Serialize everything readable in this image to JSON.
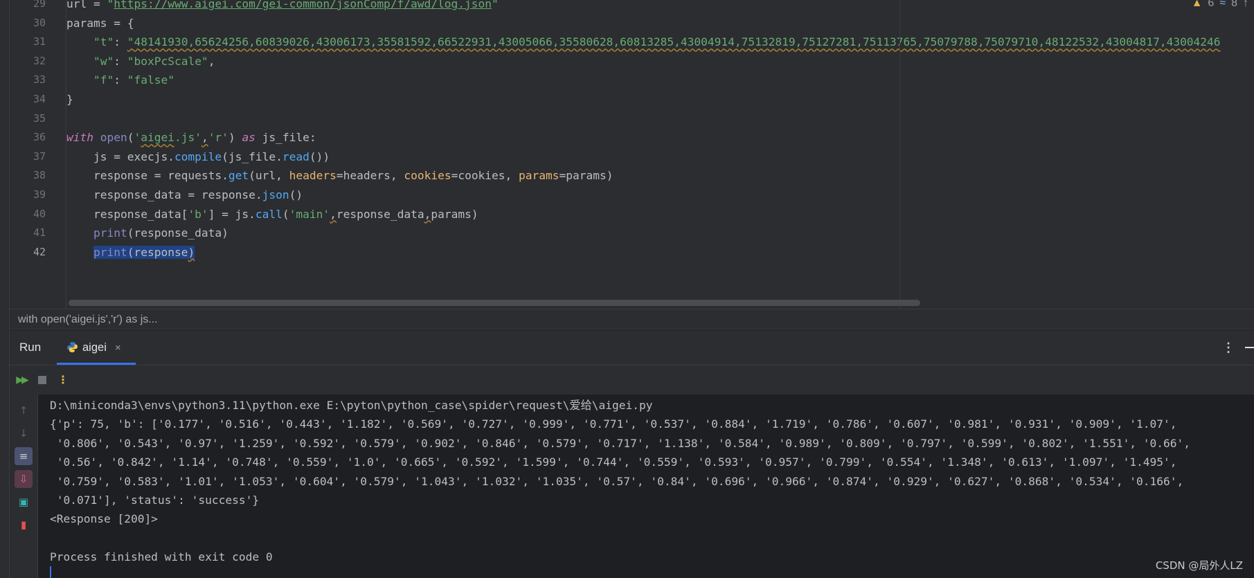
{
  "editor": {
    "line_numbers": [
      "29",
      "30",
      "31",
      "32",
      "33",
      "34",
      "35",
      "36",
      "37",
      "38",
      "39",
      "40",
      "41",
      "42"
    ],
    "lines": [
      {
        "num": "29",
        "tokens": [
          {
            "t": "url = ",
            "c": "nm"
          },
          {
            "t": "\"",
            "c": "str"
          },
          {
            "t": "https://www.aigei.com/gei-common/jsonComp/f/awd/log.json",
            "c": "url"
          },
          {
            "t": "\"",
            "c": "str"
          }
        ]
      },
      {
        "num": "30",
        "tokens": [
          {
            "t": "params = {",
            "c": "nm"
          }
        ]
      },
      {
        "num": "31",
        "tokens": [
          {
            "t": "    ",
            "c": "nm"
          },
          {
            "t": "\"t\"",
            "c": "str"
          },
          {
            "t": ": ",
            "c": "nm"
          },
          {
            "t": "\"48141930,65624256,60839026,43006173,35581592,66522931,43005066,35580628,60813285,43004914,75132819,75127281,75113765,75079788,75079710,48122532,43004817,43004246",
            "c": "str wavy"
          }
        ]
      },
      {
        "num": "32",
        "tokens": [
          {
            "t": "    ",
            "c": "nm"
          },
          {
            "t": "\"w\"",
            "c": "str"
          },
          {
            "t": ": ",
            "c": "nm"
          },
          {
            "t": "\"boxPcScale\"",
            "c": "str"
          },
          {
            "t": ",",
            "c": "nm"
          }
        ]
      },
      {
        "num": "33",
        "tokens": [
          {
            "t": "    ",
            "c": "nm"
          },
          {
            "t": "\"f\"",
            "c": "str"
          },
          {
            "t": ": ",
            "c": "nm"
          },
          {
            "t": "\"false\"",
            "c": "str"
          }
        ]
      },
      {
        "num": "34",
        "tokens": [
          {
            "t": "}",
            "c": "nm"
          }
        ]
      },
      {
        "num": "35",
        "tokens": []
      },
      {
        "num": "36",
        "tokens": [
          {
            "t": "with",
            "c": "kwp"
          },
          {
            "t": " ",
            "c": "nm"
          },
          {
            "t": "open",
            "c": "bi"
          },
          {
            "t": "(",
            "c": "nm"
          },
          {
            "t": "'",
            "c": "str"
          },
          {
            "t": "aigei",
            "c": "str wavy"
          },
          {
            "t": ".js'",
            "c": "str"
          },
          {
            "t": ",",
            "c": "nm wavy"
          },
          {
            "t": "'r'",
            "c": "str"
          },
          {
            "t": ") ",
            "c": "nm"
          },
          {
            "t": "as",
            "c": "kwp"
          },
          {
            "t": " js_file:",
            "c": "nm"
          }
        ]
      },
      {
        "num": "37",
        "tokens": [
          {
            "t": "    js = execjs.",
            "c": "nm"
          },
          {
            "t": "compile",
            "c": "fn"
          },
          {
            "t": "(js_file.",
            "c": "nm"
          },
          {
            "t": "read",
            "c": "fn"
          },
          {
            "t": "())",
            "c": "nm"
          }
        ]
      },
      {
        "num": "38",
        "tokens": [
          {
            "t": "    response = requests.",
            "c": "nm"
          },
          {
            "t": "get",
            "c": "fn"
          },
          {
            "t": "(url, ",
            "c": "nm"
          },
          {
            "t": "headers",
            "c": "param"
          },
          {
            "t": "=headers, ",
            "c": "nm"
          },
          {
            "t": "cookies",
            "c": "param"
          },
          {
            "t": "=cookies, ",
            "c": "nm"
          },
          {
            "t": "params",
            "c": "param"
          },
          {
            "t": "=params)",
            "c": "nm"
          }
        ]
      },
      {
        "num": "39",
        "tokens": [
          {
            "t": "    response_data = response.",
            "c": "nm"
          },
          {
            "t": "json",
            "c": "fn"
          },
          {
            "t": "()",
            "c": "nm"
          }
        ]
      },
      {
        "num": "40",
        "tokens": [
          {
            "t": "    response_data[",
            "c": "nm"
          },
          {
            "t": "'b'",
            "c": "str"
          },
          {
            "t": "] = js.",
            "c": "nm"
          },
          {
            "t": "call",
            "c": "fn"
          },
          {
            "t": "(",
            "c": "nm"
          },
          {
            "t": "'main'",
            "c": "str"
          },
          {
            "t": ",",
            "c": "nm wavy"
          },
          {
            "t": "response_data",
            "c": "nm"
          },
          {
            "t": ",",
            "c": "nm wavy"
          },
          {
            "t": "params)",
            "c": "nm"
          }
        ]
      },
      {
        "num": "41",
        "tokens": [
          {
            "t": "    ",
            "c": "nm"
          },
          {
            "t": "print",
            "c": "bi"
          },
          {
            "t": "(response_data)",
            "c": "nm"
          }
        ]
      },
      {
        "num": "42",
        "tokens": [
          {
            "t": "    ",
            "c": "nm"
          },
          {
            "t": "print",
            "c": "bi hl-sel"
          },
          {
            "t": "(response",
            "c": "nm hl-sel"
          },
          {
            "t": ")",
            "c": "nm hl-sel wavy"
          }
        ]
      }
    ],
    "inspections": {
      "warnings": "6",
      "weak_warnings": "8"
    }
  },
  "breadcrumb": "with open('aigei.js','r') as js...",
  "run_panel": {
    "title": "Run",
    "tab_label": "aigei",
    "tab_close": "×",
    "menu": "⋮"
  },
  "console": {
    "lines": [
      "D:\\miniconda3\\envs\\python3.11\\python.exe E:\\pyton\\python_case\\spider\\request\\爱给\\aigei.py",
      "{'p': 75, 'b': ['0.177', '0.516', '0.443', '1.182', '0.569', '0.727', '0.999', '0.771', '0.537', '0.884', '1.719', '0.786', '0.607', '0.981', '0.931', '0.909', '1.07',",
      " '0.806', '0.543', '0.97', '1.259', '0.592', '0.579', '0.902', '0.846', '0.579', '0.717', '1.138', '0.584', '0.989', '0.809', '0.797', '0.599', '0.802', '1.551', '0.66',",
      " '0.56', '0.842', '1.14', '0.748', '0.559', '1.0', '0.665', '0.592', '1.599', '0.744', '0.559', '0.593', '0.957', '0.799', '0.554', '1.348', '0.613', '1.097', '1.495',",
      " '0.759', '0.583', '1.01', '1.053', '0.604', '0.579', '1.043', '1.032', '1.035', '0.57', '0.84', '0.696', '0.966', '0.874', '0.929', '0.627', '0.868', '0.534', '0.166',",
      " '0.071'], 'status': 'success'}",
      "<Response [200]>",
      "",
      "Process finished with exit code 0"
    ]
  },
  "watermark": "CSDN @局外人LZ",
  "colors": {
    "accent": "#3574f0",
    "string": "#6aab73",
    "keyword": "#c77dbb",
    "function": "#56a8f5",
    "param": "#e8b573",
    "warning": "#e0b44a"
  }
}
